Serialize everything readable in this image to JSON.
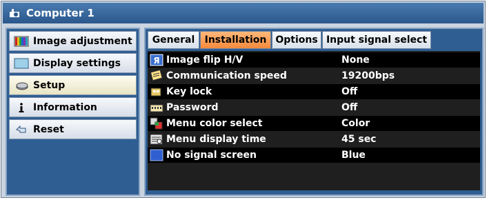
{
  "window": {
    "title": "Computer 1",
    "title_icon": "projector-icon"
  },
  "sidebar": {
    "items": [
      {
        "label": "Image adjustment",
        "icon": "image-adjustment-icon"
      },
      {
        "label": "Display settings",
        "icon": "display-settings-icon"
      },
      {
        "label": "Setup",
        "icon": "setup-icon",
        "selected": true
      },
      {
        "label": "Information",
        "icon": "information-icon"
      },
      {
        "label": "Reset",
        "icon": "reset-icon"
      }
    ]
  },
  "tabs": [
    {
      "label": "General"
    },
    {
      "label": "Installation",
      "active": true
    },
    {
      "label": "Options"
    },
    {
      "label": "Input signal select"
    }
  ],
  "settings": [
    {
      "label": "Image flip H/V",
      "value": "None",
      "icon": "image-flip-icon"
    },
    {
      "label": "Communication speed",
      "value": "19200bps",
      "icon": "communication-icon"
    },
    {
      "label": "Key lock",
      "value": "Off",
      "icon": "key-lock-icon"
    },
    {
      "label": "Password",
      "value": "Off",
      "icon": "password-icon"
    },
    {
      "label": "Menu color select",
      "value": "Color",
      "icon": "menu-color-icon"
    },
    {
      "label": "Menu display time",
      "value": "45 sec",
      "icon": "menu-time-icon"
    },
    {
      "label": "No signal screen",
      "value": "Blue",
      "icon": "no-signal-icon"
    }
  ],
  "colors": {
    "active_tab": "#f58a3c",
    "title_bar": "#2a578c",
    "panel": "#2f5e93",
    "no_signal_blue": "#2f5fd0"
  }
}
